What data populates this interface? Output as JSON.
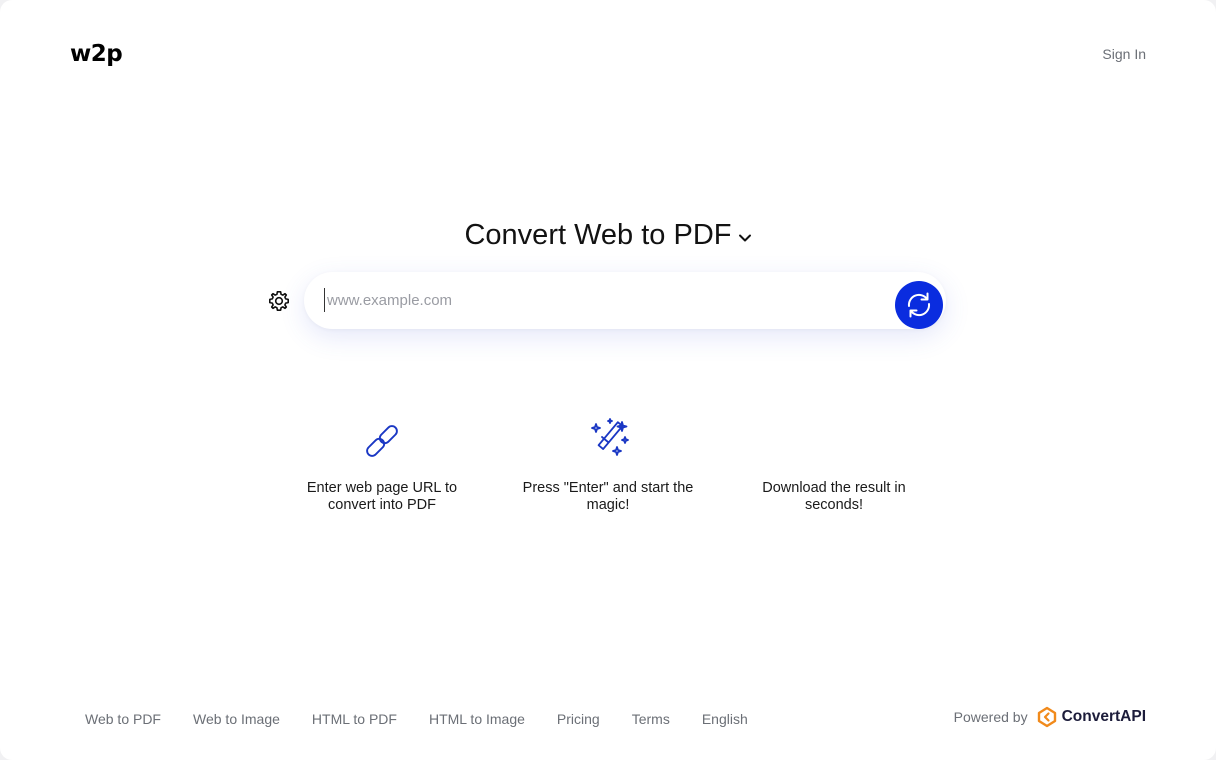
{
  "header": {
    "logo": "w2p",
    "sign_in": "Sign In"
  },
  "main": {
    "title": "Convert Web to PDF",
    "title_icon": "chevron-down-icon",
    "settings_icon": "gear-icon",
    "url_input": {
      "placeholder": "www.example.com",
      "value": ""
    },
    "convert_icon": "refresh-icon",
    "accent_color": "#0a2cdf"
  },
  "features": [
    {
      "icon": "link-icon",
      "text": "Enter web page URL to convert into PDF"
    },
    {
      "icon": "magic-wand-icon",
      "text": "Press \"Enter\" and start the magic!"
    },
    {
      "icon": "",
      "text": "Download the result in seconds!"
    }
  ],
  "footer": {
    "links": [
      "Web to PDF",
      "Web to Image",
      "HTML to PDF",
      "HTML to Image",
      "Pricing",
      "Terms",
      "English"
    ],
    "powered_by": "Powered by",
    "brand": "ConvertAPI",
    "brand_color": "#f18a1b"
  }
}
